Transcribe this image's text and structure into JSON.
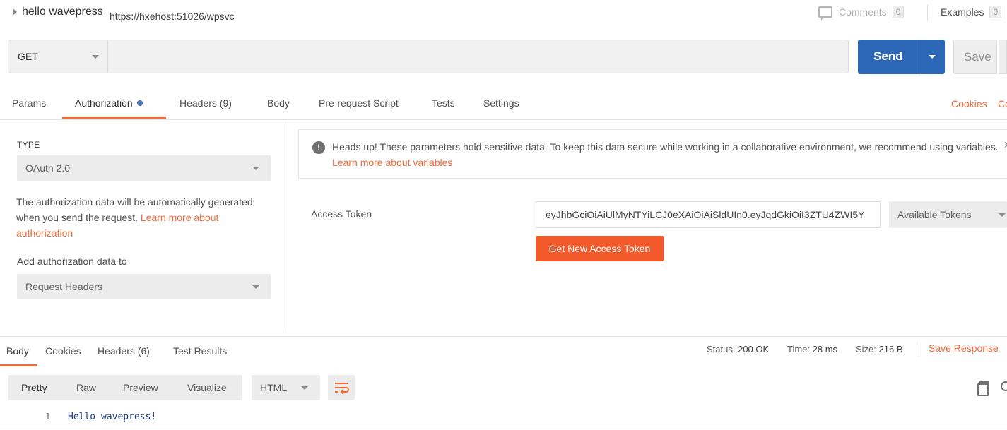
{
  "request": {
    "name": "hello wavepress",
    "comments_label": "Comments",
    "comments_count": "0",
    "examples_label": "Examples",
    "examples_count": "0"
  },
  "urlbar": {
    "method": "GET",
    "url": "https://hxehost:51026/wpsvc",
    "send_label": "Send",
    "save_label": "Save"
  },
  "request_tabs": {
    "params": "Params",
    "authorization": "Authorization",
    "headers": "Headers (9)",
    "body": "Body",
    "prerequest": "Pre-request Script",
    "tests": "Tests",
    "settings": "Settings",
    "cookies": "Cookies",
    "code": "Co"
  },
  "auth": {
    "type_label": "TYPE",
    "type_value": "OAuth 2.0",
    "description": "The authorization data will be automatically generated when you send the request.",
    "learn_more": "Learn more about authorization",
    "add_to_label": "Add authorization data to",
    "add_to_value": "Request Headers"
  },
  "alert": {
    "text": "Heads up! These parameters hold sensitive data. To keep this data secure while working in a collaborative environment, we recommend using variables.",
    "link": "Learn more about variables"
  },
  "token": {
    "label": "Access Token",
    "value": "eyJhbGciOiAiUlMyNTYiLCJ0eXAiOiAiSldUIn0.eyJqdGkiOiI3ZTU4ZWI5Y",
    "available_label": "Available Tokens",
    "get_new_label": "Get New Access Token"
  },
  "response": {
    "tabs": {
      "body": "Body",
      "cookies": "Cookies",
      "headers": "Headers (6)",
      "test_results": "Test Results"
    },
    "status_label": "Status:",
    "status_value": "200 OK",
    "time_label": "Time:",
    "time_value": "28 ms",
    "size_label": "Size:",
    "size_value": "216 B",
    "save_label": "Save Response",
    "view_options": [
      "Pretty",
      "Raw",
      "Preview",
      "Visualize"
    ],
    "format": "HTML",
    "lines": [
      {
        "no": "1",
        "text": "Hello wavepress!"
      }
    ]
  },
  "colors": {
    "accent": "#f26b3a",
    "send": "#2d68b8",
    "get_token": "#f25a2c"
  }
}
